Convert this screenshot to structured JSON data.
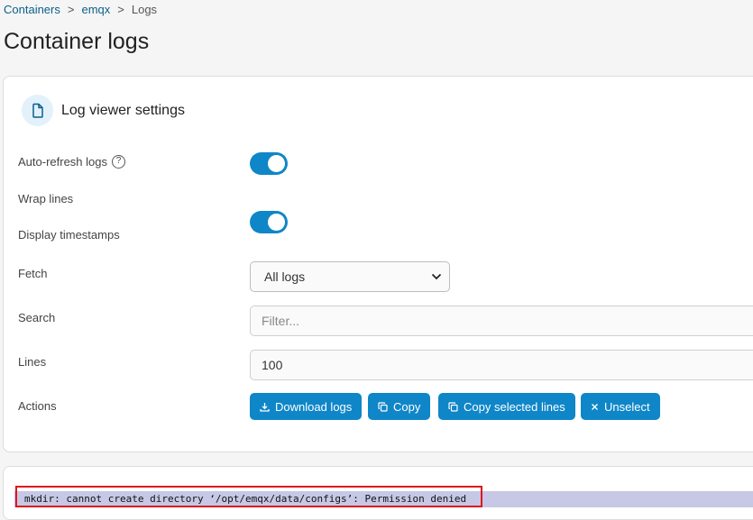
{
  "breadcrumb": {
    "items": [
      "Containers",
      "emqx",
      "Logs"
    ],
    "separator": ">"
  },
  "page_title": "Container logs",
  "settings": {
    "title": "Log viewer settings",
    "auto_refresh": {
      "label": "Auto-refresh logs",
      "enabled": true
    },
    "wrap_lines": {
      "label": "Wrap lines",
      "enabled": true
    },
    "display_timestamps": {
      "label": "Display timestamps",
      "enabled": false
    },
    "fetch": {
      "label": "Fetch",
      "value": "All logs"
    },
    "search": {
      "label": "Search",
      "placeholder": "Filter..."
    },
    "lines": {
      "label": "Lines",
      "value": "100"
    },
    "actions": {
      "label": "Actions",
      "download": "Download logs",
      "copy": "Copy",
      "copy_selected": "Copy selected lines",
      "unselect": "Unselect"
    }
  },
  "logs": {
    "lines": [
      "mkdir: cannot create directory ‘/opt/emqx/data/configs’: Permission denied"
    ]
  },
  "colors": {
    "accent": "#0f86c8",
    "selected_line": "#c7c8e6",
    "highlight": "#e0151c"
  }
}
